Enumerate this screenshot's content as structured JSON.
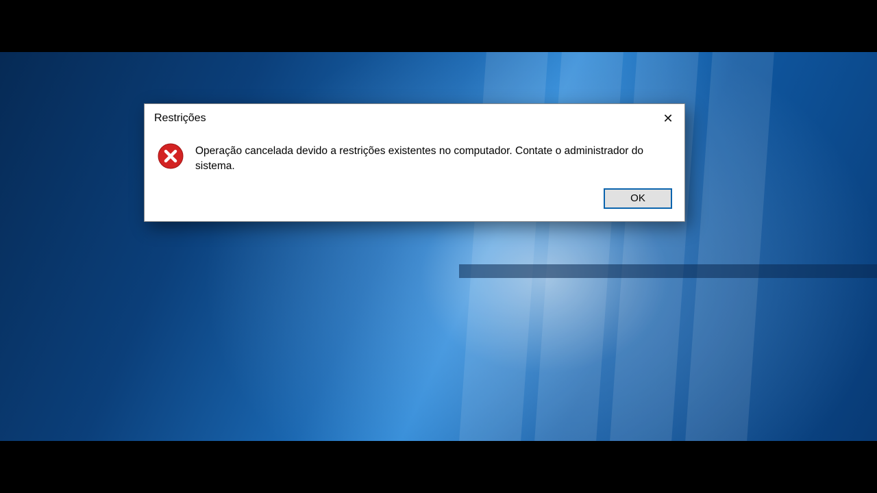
{
  "dialog": {
    "title": "Restrições",
    "message": "Operação cancelada devido a restrições existentes no computador. Contate o administrador do sistema.",
    "ok_label": "OK",
    "close_label": "✕"
  }
}
